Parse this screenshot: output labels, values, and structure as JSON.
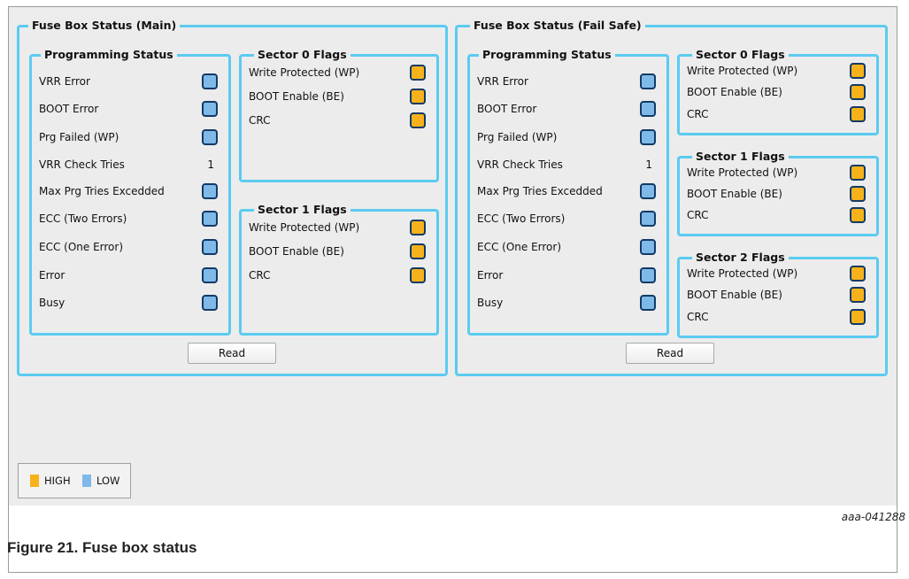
{
  "main": {
    "title": "Fuse Box Status (Main)",
    "programming": {
      "title": "Programming Status",
      "items": [
        {
          "label": "VRR Error",
          "state": "LOW"
        },
        {
          "label": "BOOT Error",
          "state": "LOW"
        },
        {
          "label": "Prg Failed (WP)",
          "state": "LOW"
        },
        {
          "label": "VRR Check Tries",
          "value": "1"
        },
        {
          "label": "Max Prg Tries Excedded",
          "state": "LOW"
        },
        {
          "label": "ECC (Two Errors)",
          "state": "LOW"
        },
        {
          "label": "ECC (One Error)",
          "state": "LOW"
        },
        {
          "label": "Error",
          "state": "LOW"
        },
        {
          "label": "Busy",
          "state": "LOW"
        }
      ]
    },
    "sectors": [
      {
        "title": "Sector 0 Flags",
        "items": [
          {
            "label": "Write Protected (WP)",
            "state": "HIGH"
          },
          {
            "label": "BOOT Enable (BE)",
            "state": "HIGH"
          },
          {
            "label": "CRC",
            "state": "HIGH"
          }
        ]
      },
      {
        "title": "Sector 1  Flags",
        "items": [
          {
            "label": "Write Protected (WP)",
            "state": "HIGH"
          },
          {
            "label": "BOOT Enable (BE)",
            "state": "HIGH"
          },
          {
            "label": "CRC",
            "state": "HIGH"
          }
        ]
      }
    ],
    "read_label": "Read"
  },
  "failsafe": {
    "title": "Fuse Box Status (Fail Safe)",
    "programming": {
      "title": "Programming Status",
      "items": [
        {
          "label": "VRR Error",
          "state": "LOW"
        },
        {
          "label": "BOOT Error",
          "state": "LOW"
        },
        {
          "label": "Prg Failed (WP)",
          "state": "LOW"
        },
        {
          "label": "VRR Check Tries",
          "value": "1"
        },
        {
          "label": "Max Prg Tries Excedded",
          "state": "LOW"
        },
        {
          "label": "ECC (Two Errors)",
          "state": "LOW"
        },
        {
          "label": "ECC (One Error)",
          "state": "LOW"
        },
        {
          "label": "Error",
          "state": "LOW"
        },
        {
          "label": "Busy",
          "state": "LOW"
        }
      ]
    },
    "sectors": [
      {
        "title": "Sector 0 Flags",
        "items": [
          {
            "label": "Write Protected (WP)",
            "state": "HIGH"
          },
          {
            "label": "BOOT Enable (BE)",
            "state": "HIGH"
          },
          {
            "label": "CRC",
            "state": "HIGH"
          }
        ]
      },
      {
        "title": "Sector 1  Flags",
        "items": [
          {
            "label": "Write Protected (WP)",
            "state": "HIGH"
          },
          {
            "label": "BOOT Enable (BE)",
            "state": "HIGH"
          },
          {
            "label": "CRC",
            "state": "HIGH"
          }
        ]
      },
      {
        "title": "Sector 2  Flags",
        "items": [
          {
            "label": "Write Protected (WP)",
            "state": "HIGH"
          },
          {
            "label": "BOOT Enable (BE)",
            "state": "HIGH"
          },
          {
            "label": "CRC",
            "state": "HIGH"
          }
        ]
      }
    ],
    "read_label": "Read"
  },
  "legend": {
    "high_label": "HIGH",
    "low_label": "LOW"
  },
  "colors": {
    "high": "#f5b21a",
    "low": "#7fb9e8",
    "frame": "#5bcbf0"
  },
  "figure_id": "aaa-041288",
  "caption": "Figure 21.  Fuse box status"
}
